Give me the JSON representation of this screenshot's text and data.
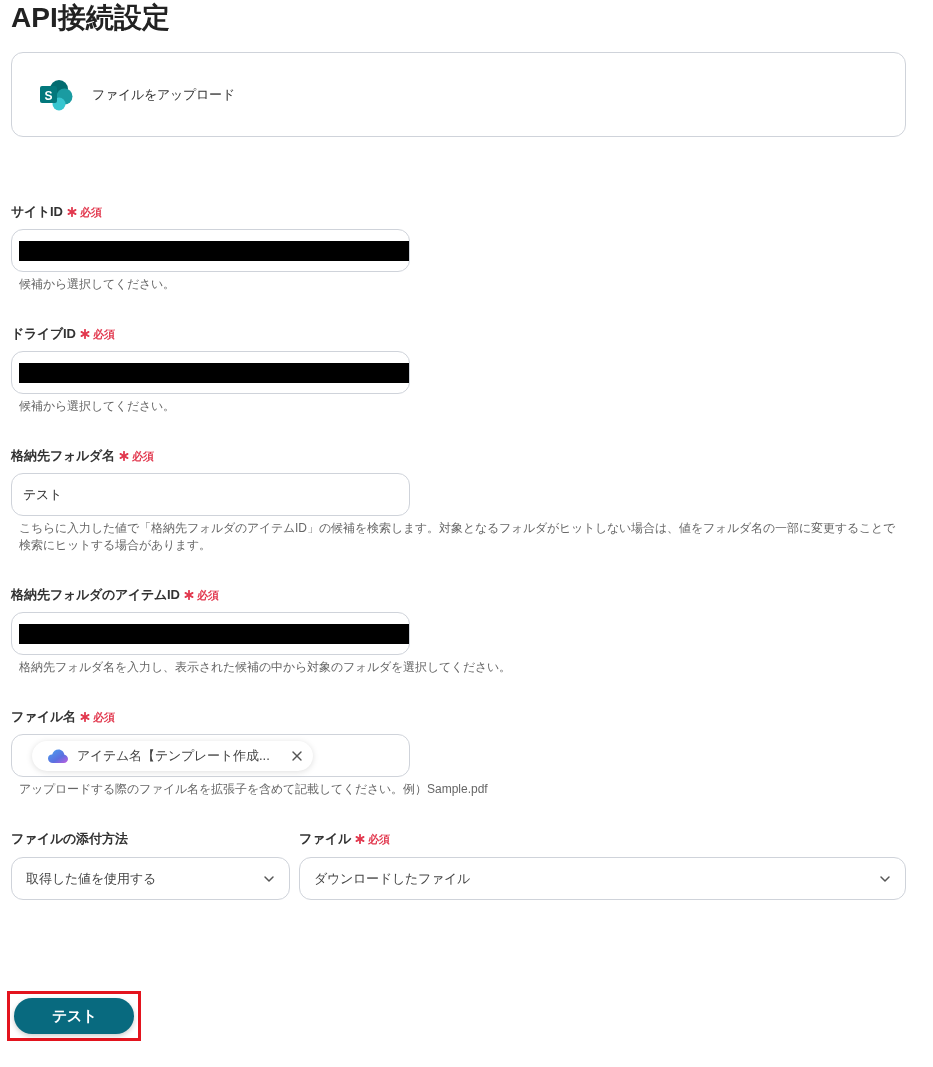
{
  "title": "API接続設定",
  "app": {
    "icon_letter": "S",
    "action": "ファイルをアップロード"
  },
  "fields": [
    {
      "kind": "redacted",
      "label": "サイトID",
      "required": true,
      "required_label": "必須",
      "hint": "候補から選択してください。"
    },
    {
      "kind": "redacted",
      "label": "ドライブID",
      "required": true,
      "required_label": "必須",
      "hint": "候補から選択してください。"
    },
    {
      "kind": "text",
      "label": "格納先フォルダ名",
      "required": true,
      "required_label": "必須",
      "value": "テスト",
      "hint": "こちらに入力した値で「格納先フォルダのアイテムID」の候補を検索します。対象となるフォルダがヒットしない場合は、値をフォルダ名の一部に変更することで検索にヒットする場合があります。"
    },
    {
      "kind": "redacted",
      "label": "格納先フォルダのアイテムID",
      "required": true,
      "required_label": "必須",
      "hint": "格納先フォルダ名を入力し、表示された候補の中から対象のフォルダを選択してください。"
    },
    {
      "kind": "chip",
      "label": "ファイル名",
      "required": true,
      "required_label": "必須",
      "chip": "アイテム名【テンプレート作成...",
      "hint": "アップロードする際のファイル名を拡張子を含めて記載してください。例）Sample.pdf"
    }
  ],
  "selects": [
    {
      "label": "ファイルの添付方法",
      "required": false,
      "value": "取得した値を使用する"
    },
    {
      "label": "ファイル",
      "required": true,
      "required_label": "必須",
      "value": "ダウンロードしたファイル"
    }
  ],
  "test_button": {
    "label": "テスト",
    "highlighted": true
  }
}
